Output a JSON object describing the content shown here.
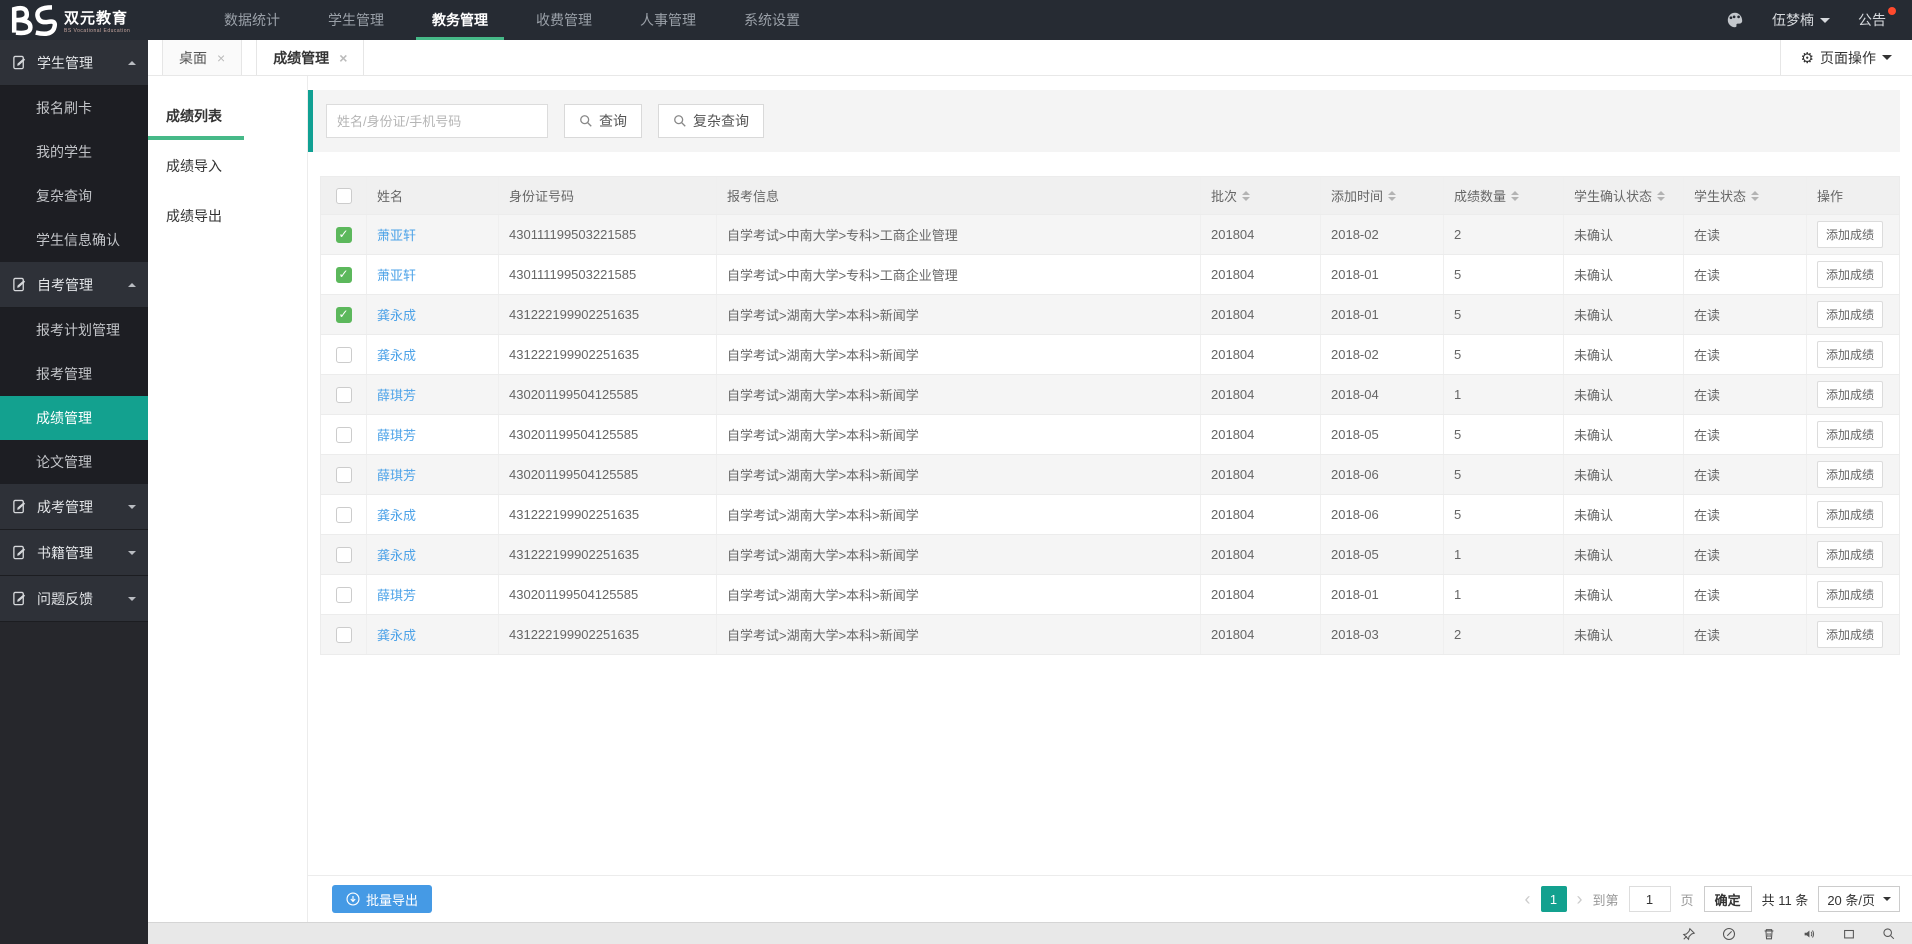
{
  "topnav": {
    "brand": "双元教育",
    "brand_sub": "BS Vocational Education",
    "items": [
      "数据统计",
      "学生管理",
      "教务管理",
      "收费管理",
      "人事管理",
      "系统设置"
    ],
    "active_item": "教务管理",
    "user_name": "伍梦楠",
    "announcement_label": "公告"
  },
  "sidebar": {
    "groups": [
      {
        "label": "学生管理",
        "expanded": true,
        "items": [
          "报名刷卡",
          "我的学生",
          "复杂查询",
          "学生信息确认"
        ]
      },
      {
        "label": "自考管理",
        "expanded": true,
        "items": [
          "报考计划管理",
          "报考管理",
          "成绩管理",
          "论文管理"
        ],
        "active_item": "成绩管理"
      },
      {
        "label": "成考管理",
        "expanded": false,
        "items": []
      },
      {
        "label": "书籍管理",
        "expanded": false,
        "items": []
      },
      {
        "label": "问题反馈",
        "expanded": false,
        "items": []
      }
    ]
  },
  "tabbar": {
    "tabs": [
      {
        "label": "桌面"
      },
      {
        "label": "成绩管理",
        "active": true
      }
    ],
    "page_actions_label": "页面操作"
  },
  "subnav": {
    "items": [
      "成绩列表",
      "成绩导入",
      "成绩导出"
    ],
    "active": "成绩列表"
  },
  "search": {
    "placeholder": "姓名/身份证/手机号码",
    "query_label": "查询",
    "complex_query_label": "复杂查询"
  },
  "table": {
    "headers": [
      "姓名",
      "身份证号码",
      "报考信息",
      "批次",
      "添加时间",
      "成绩数量",
      "学生确认状态",
      "学生状态",
      "操作"
    ],
    "action_label": "添加成绩",
    "rows": [
      {
        "checked": true,
        "name": "萧亚轩",
        "id_number": "430111199503221585",
        "apply_info": "自学考试>中南大学>专科>工商企业管理",
        "batch": "201804",
        "added_time": "2018-02",
        "score_count": "2",
        "confirm_status": "未确认",
        "student_status": "在读"
      },
      {
        "checked": true,
        "name": "萧亚轩",
        "id_number": "430111199503221585",
        "apply_info": "自学考试>中南大学>专科>工商企业管理",
        "batch": "201804",
        "added_time": "2018-01",
        "score_count": "5",
        "confirm_status": "未确认",
        "student_status": "在读"
      },
      {
        "checked": true,
        "name": "龚永成",
        "id_number": "431222199902251635",
        "apply_info": "自学考试>湖南大学>本科>新闻学",
        "batch": "201804",
        "added_time": "2018-01",
        "score_count": "5",
        "confirm_status": "未确认",
        "student_status": "在读"
      },
      {
        "checked": false,
        "name": "龚永成",
        "id_number": "431222199902251635",
        "apply_info": "自学考试>湖南大学>本科>新闻学",
        "batch": "201804",
        "added_time": "2018-02",
        "score_count": "5",
        "confirm_status": "未确认",
        "student_status": "在读"
      },
      {
        "checked": false,
        "name": "薛琪芳",
        "id_number": "430201199504125585",
        "apply_info": "自学考试>湖南大学>本科>新闻学",
        "batch": "201804",
        "added_time": "2018-04",
        "score_count": "1",
        "confirm_status": "未确认",
        "student_status": "在读"
      },
      {
        "checked": false,
        "name": "薛琪芳",
        "id_number": "430201199504125585",
        "apply_info": "自学考试>湖南大学>本科>新闻学",
        "batch": "201804",
        "added_time": "2018-05",
        "score_count": "5",
        "confirm_status": "未确认",
        "student_status": "在读"
      },
      {
        "checked": false,
        "name": "薛琪芳",
        "id_number": "430201199504125585",
        "apply_info": "自学考试>湖南大学>本科>新闻学",
        "batch": "201804",
        "added_time": "2018-06",
        "score_count": "5",
        "confirm_status": "未确认",
        "student_status": "在读"
      },
      {
        "checked": false,
        "name": "龚永成",
        "id_number": "431222199902251635",
        "apply_info": "自学考试>湖南大学>本科>新闻学",
        "batch": "201804",
        "added_time": "2018-06",
        "score_count": "5",
        "confirm_status": "未确认",
        "student_status": "在读"
      },
      {
        "checked": false,
        "name": "龚永成",
        "id_number": "431222199902251635",
        "apply_info": "自学考试>湖南大学>本科>新闻学",
        "batch": "201804",
        "added_time": "2018-05",
        "score_count": "1",
        "confirm_status": "未确认",
        "student_status": "在读"
      },
      {
        "checked": false,
        "name": "薛琪芳",
        "id_number": "430201199504125585",
        "apply_info": "自学考试>湖南大学>本科>新闻学",
        "batch": "201804",
        "added_time": "2018-01",
        "score_count": "1",
        "confirm_status": "未确认",
        "student_status": "在读"
      },
      {
        "checked": false,
        "name": "龚永成",
        "id_number": "431222199902251635",
        "apply_info": "自学考试>湖南大学>本科>新闻学",
        "batch": "201804",
        "added_time": "2018-03",
        "score_count": "2",
        "confirm_status": "未确认",
        "student_status": "在读"
      }
    ]
  },
  "footer": {
    "batch_export_label": "批量导出",
    "pagination": {
      "page": "1",
      "goto_prefix": "到第",
      "goto_value": "1",
      "goto_suffix": "页",
      "confirm_label": "确定",
      "total_label": "共 11 条",
      "page_size_label": "20 条/页"
    }
  },
  "colors": {
    "accent_green": "#46b988",
    "teal": "#13a18f",
    "link_blue": "#4da3e8",
    "export_blue": "#459ae5",
    "badge_red": "#ff4a2d"
  }
}
